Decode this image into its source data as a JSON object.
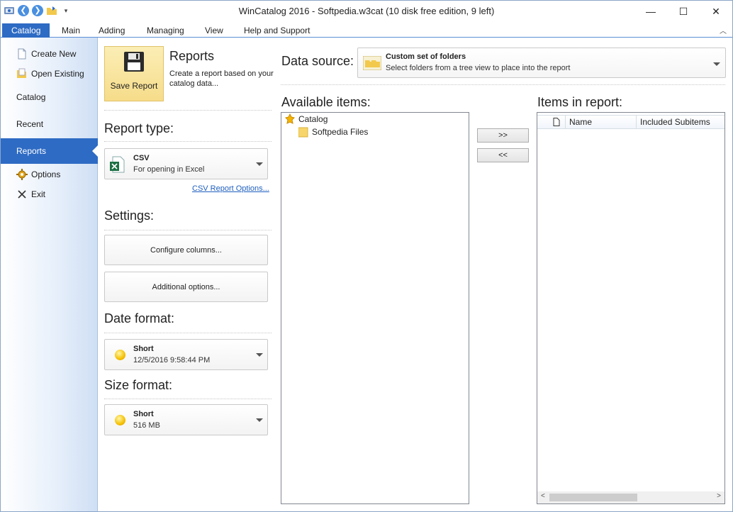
{
  "window": {
    "title": "WinCatalog 2016 - Softpedia.w3cat (10 disk free edition, 9 left)",
    "controls": {
      "minimize": "—",
      "maximize": "☐",
      "close": "✕"
    }
  },
  "ribbon": {
    "tabs": [
      {
        "label": "Catalog",
        "active": true
      },
      {
        "label": "Main"
      },
      {
        "label": "Adding"
      },
      {
        "label": "Managing"
      },
      {
        "label": "View"
      },
      {
        "label": "Help and Support"
      }
    ],
    "collapse_glyph": "︿"
  },
  "nav": {
    "items": [
      {
        "label": "Create New",
        "icon": "new-document-icon"
      },
      {
        "label": "Open Existing",
        "icon": "open-folder-icon"
      },
      {
        "label": "Catalog"
      },
      {
        "label": "Recent"
      },
      {
        "label": "Reports",
        "active": true
      },
      {
        "label": "Options",
        "icon": "gear-icon"
      },
      {
        "label": "Exit",
        "icon": "close-x-icon"
      }
    ]
  },
  "reports": {
    "save_button": "Save Report",
    "title": "Reports",
    "description": "Create a report based on your catalog data...",
    "report_type_label": "Report type:",
    "report_type": {
      "title": "CSV",
      "subtitle": "For opening in Excel"
    },
    "csv_options_link": "CSV Report Options...",
    "settings_label": "Settings:",
    "configure_columns": "Configure columns...",
    "additional_options": "Additional options...",
    "date_format_label": "Date format:",
    "date_format": {
      "title": "Short",
      "subtitle": "12/5/2016 9:58:44 PM"
    },
    "size_format_label": "Size format:",
    "size_format": {
      "title": "Short",
      "subtitle": "516 MB"
    }
  },
  "data_source": {
    "label": "Data source:",
    "title": "Custom set of folders",
    "subtitle": "Select folders from a tree view to place into the report"
  },
  "available": {
    "label": "Available items:",
    "tree": [
      {
        "label": "Catalog",
        "level": 0,
        "icon": "catalog-star-icon"
      },
      {
        "label": "Softpedia Files",
        "level": 1,
        "icon": "folder-icon"
      }
    ]
  },
  "move": {
    "add": ">>",
    "remove": "<<"
  },
  "in_report": {
    "label": "Items in report:",
    "columns": [
      "Name",
      "Included Subitems"
    ],
    "scroll": {
      "left": "<",
      "right": ">"
    }
  },
  "colors": {
    "accent": "#2e6bc4",
    "save_button_bg": "#f6dc8a",
    "link": "#1f5fbf"
  }
}
